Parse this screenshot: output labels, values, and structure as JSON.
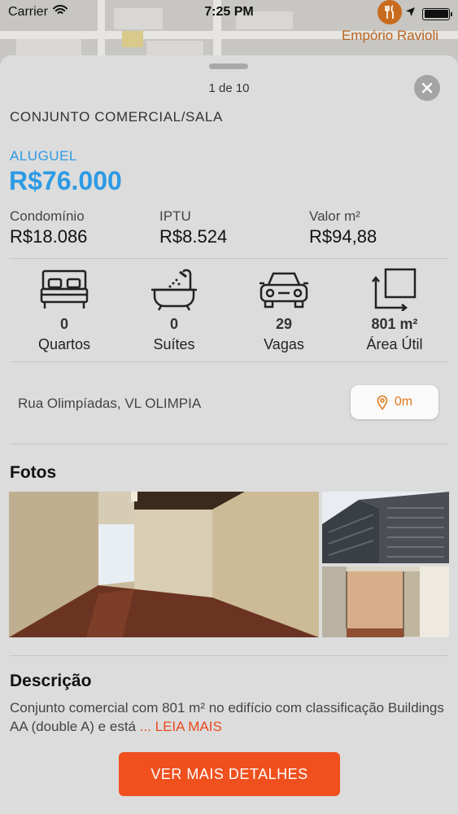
{
  "status_bar": {
    "carrier": "Carrier",
    "time": "7:25 PM"
  },
  "map": {
    "poi_label": "Empório Ravioli"
  },
  "sheet": {
    "pager": "1 de 10",
    "property_type": "CONJUNTO COMERCIAL/SALA",
    "operation": "ALUGUEL",
    "price": "R$76.000",
    "costs": [
      {
        "label": "Condomínio",
        "value": "R$18.086"
      },
      {
        "label": "IPTU",
        "value": "R$8.524"
      },
      {
        "label": "Valor m²",
        "value": "R$94,88"
      }
    ],
    "features": [
      {
        "icon": "bed-icon",
        "value": "0",
        "label": "Quartos"
      },
      {
        "icon": "bathtub-icon",
        "value": "0",
        "label": "Suítes"
      },
      {
        "icon": "car-icon",
        "value": "29",
        "label": "Vagas"
      },
      {
        "icon": "area-icon",
        "value": "801 m²",
        "label": "Área Útil"
      }
    ],
    "address": "Rua Olimpíadas, VL OLIMPIA",
    "distance": "0m",
    "photos_title": "Fotos",
    "description_title": "Descrição",
    "description_text": "Conjunto comercial com 801 m² no edifício com classificação Buildings AA (double A) e está",
    "read_more": "... LEIA MAIS",
    "cta": "VER MAIS DETALHES"
  },
  "colors": {
    "accent_blue": "#2d9ae4",
    "accent_orange": "#f0501e",
    "pin_orange": "#e07a1c"
  }
}
